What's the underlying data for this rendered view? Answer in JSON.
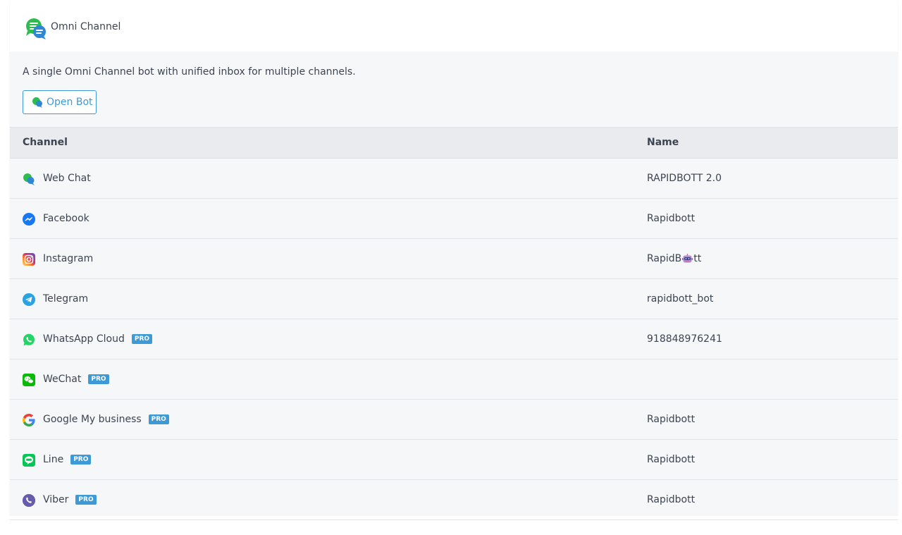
{
  "header": {
    "title": "Omni Channel",
    "logo_icon": "omni-chat-bubbles-icon"
  },
  "description": "A single Omni Channel bot with unified inbox for multiple channels.",
  "open_bot": {
    "label": "Open Bot",
    "icon": "webchat-bubbles-icon"
  },
  "colors": {
    "accent": "#3d9ad6",
    "pro_badge": "#3d9ad6",
    "header_bg": "#e9ebee",
    "body_bg": "#f6f7f9"
  },
  "table": {
    "columns": [
      "Channel",
      "Name"
    ],
    "pro_label": "PRO",
    "rows": [
      {
        "channel": "Web Chat",
        "icon": "webchat-icon",
        "pro": false,
        "name": "RAPIDBOTT 2.0"
      },
      {
        "channel": "Facebook",
        "icon": "messenger-icon",
        "pro": false,
        "name": "Rapidbott"
      },
      {
        "channel": "Instagram",
        "icon": "instagram-icon",
        "pro": false,
        "name_prefix": "RapidB",
        "name_suffix": "tt",
        "name_emoji": "robot-emoji-icon"
      },
      {
        "channel": "Telegram",
        "icon": "telegram-icon",
        "pro": false,
        "name": "rapidbott_bot"
      },
      {
        "channel": "WhatsApp Cloud",
        "icon": "whatsapp-icon",
        "pro": true,
        "name": "918848976241"
      },
      {
        "channel": "WeChat",
        "icon": "wechat-icon",
        "pro": true,
        "name": ""
      },
      {
        "channel": "Google My business",
        "icon": "google-icon",
        "pro": true,
        "name": "Rapidbott"
      },
      {
        "channel": "Line",
        "icon": "line-icon",
        "pro": true,
        "name": "Rapidbott"
      },
      {
        "channel": "Viber",
        "icon": "viber-icon",
        "pro": true,
        "name": "Rapidbott"
      }
    ]
  }
}
